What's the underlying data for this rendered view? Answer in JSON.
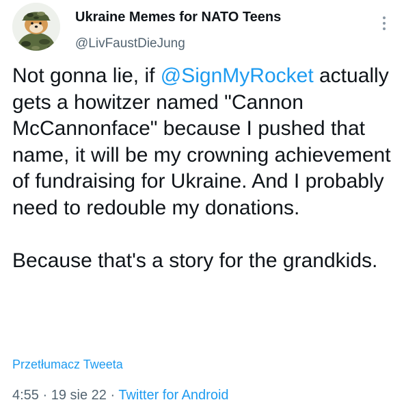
{
  "author": {
    "display_name": "Ukraine Memes for NATO Teens",
    "handle": "@LivFaustDieJung",
    "avatar_icon": "shiba-dog-camouflage-avatar"
  },
  "more_icon": "vertical-dots-icon",
  "tweet": {
    "p1_before": "Not gonna lie, if ",
    "mention": "@SignMyRocket",
    "p1_after": " actually gets a howitzer named \"Cannon McCannonface\" because I pushed that name, it will be my crowning achievement of fundraising for Ukraine. And I probably need to redouble my donations.",
    "p2": "Because that's a story for the grandkids."
  },
  "translate_link": "Przetłumacz Tweeta",
  "meta": {
    "time": "4:55",
    "separator": "·",
    "date": "19 sie 22",
    "source": "Twitter for Android"
  },
  "colors": {
    "link": "#1d9bf0",
    "secondary_text": "#536471",
    "primary_text": "#0f1419"
  }
}
